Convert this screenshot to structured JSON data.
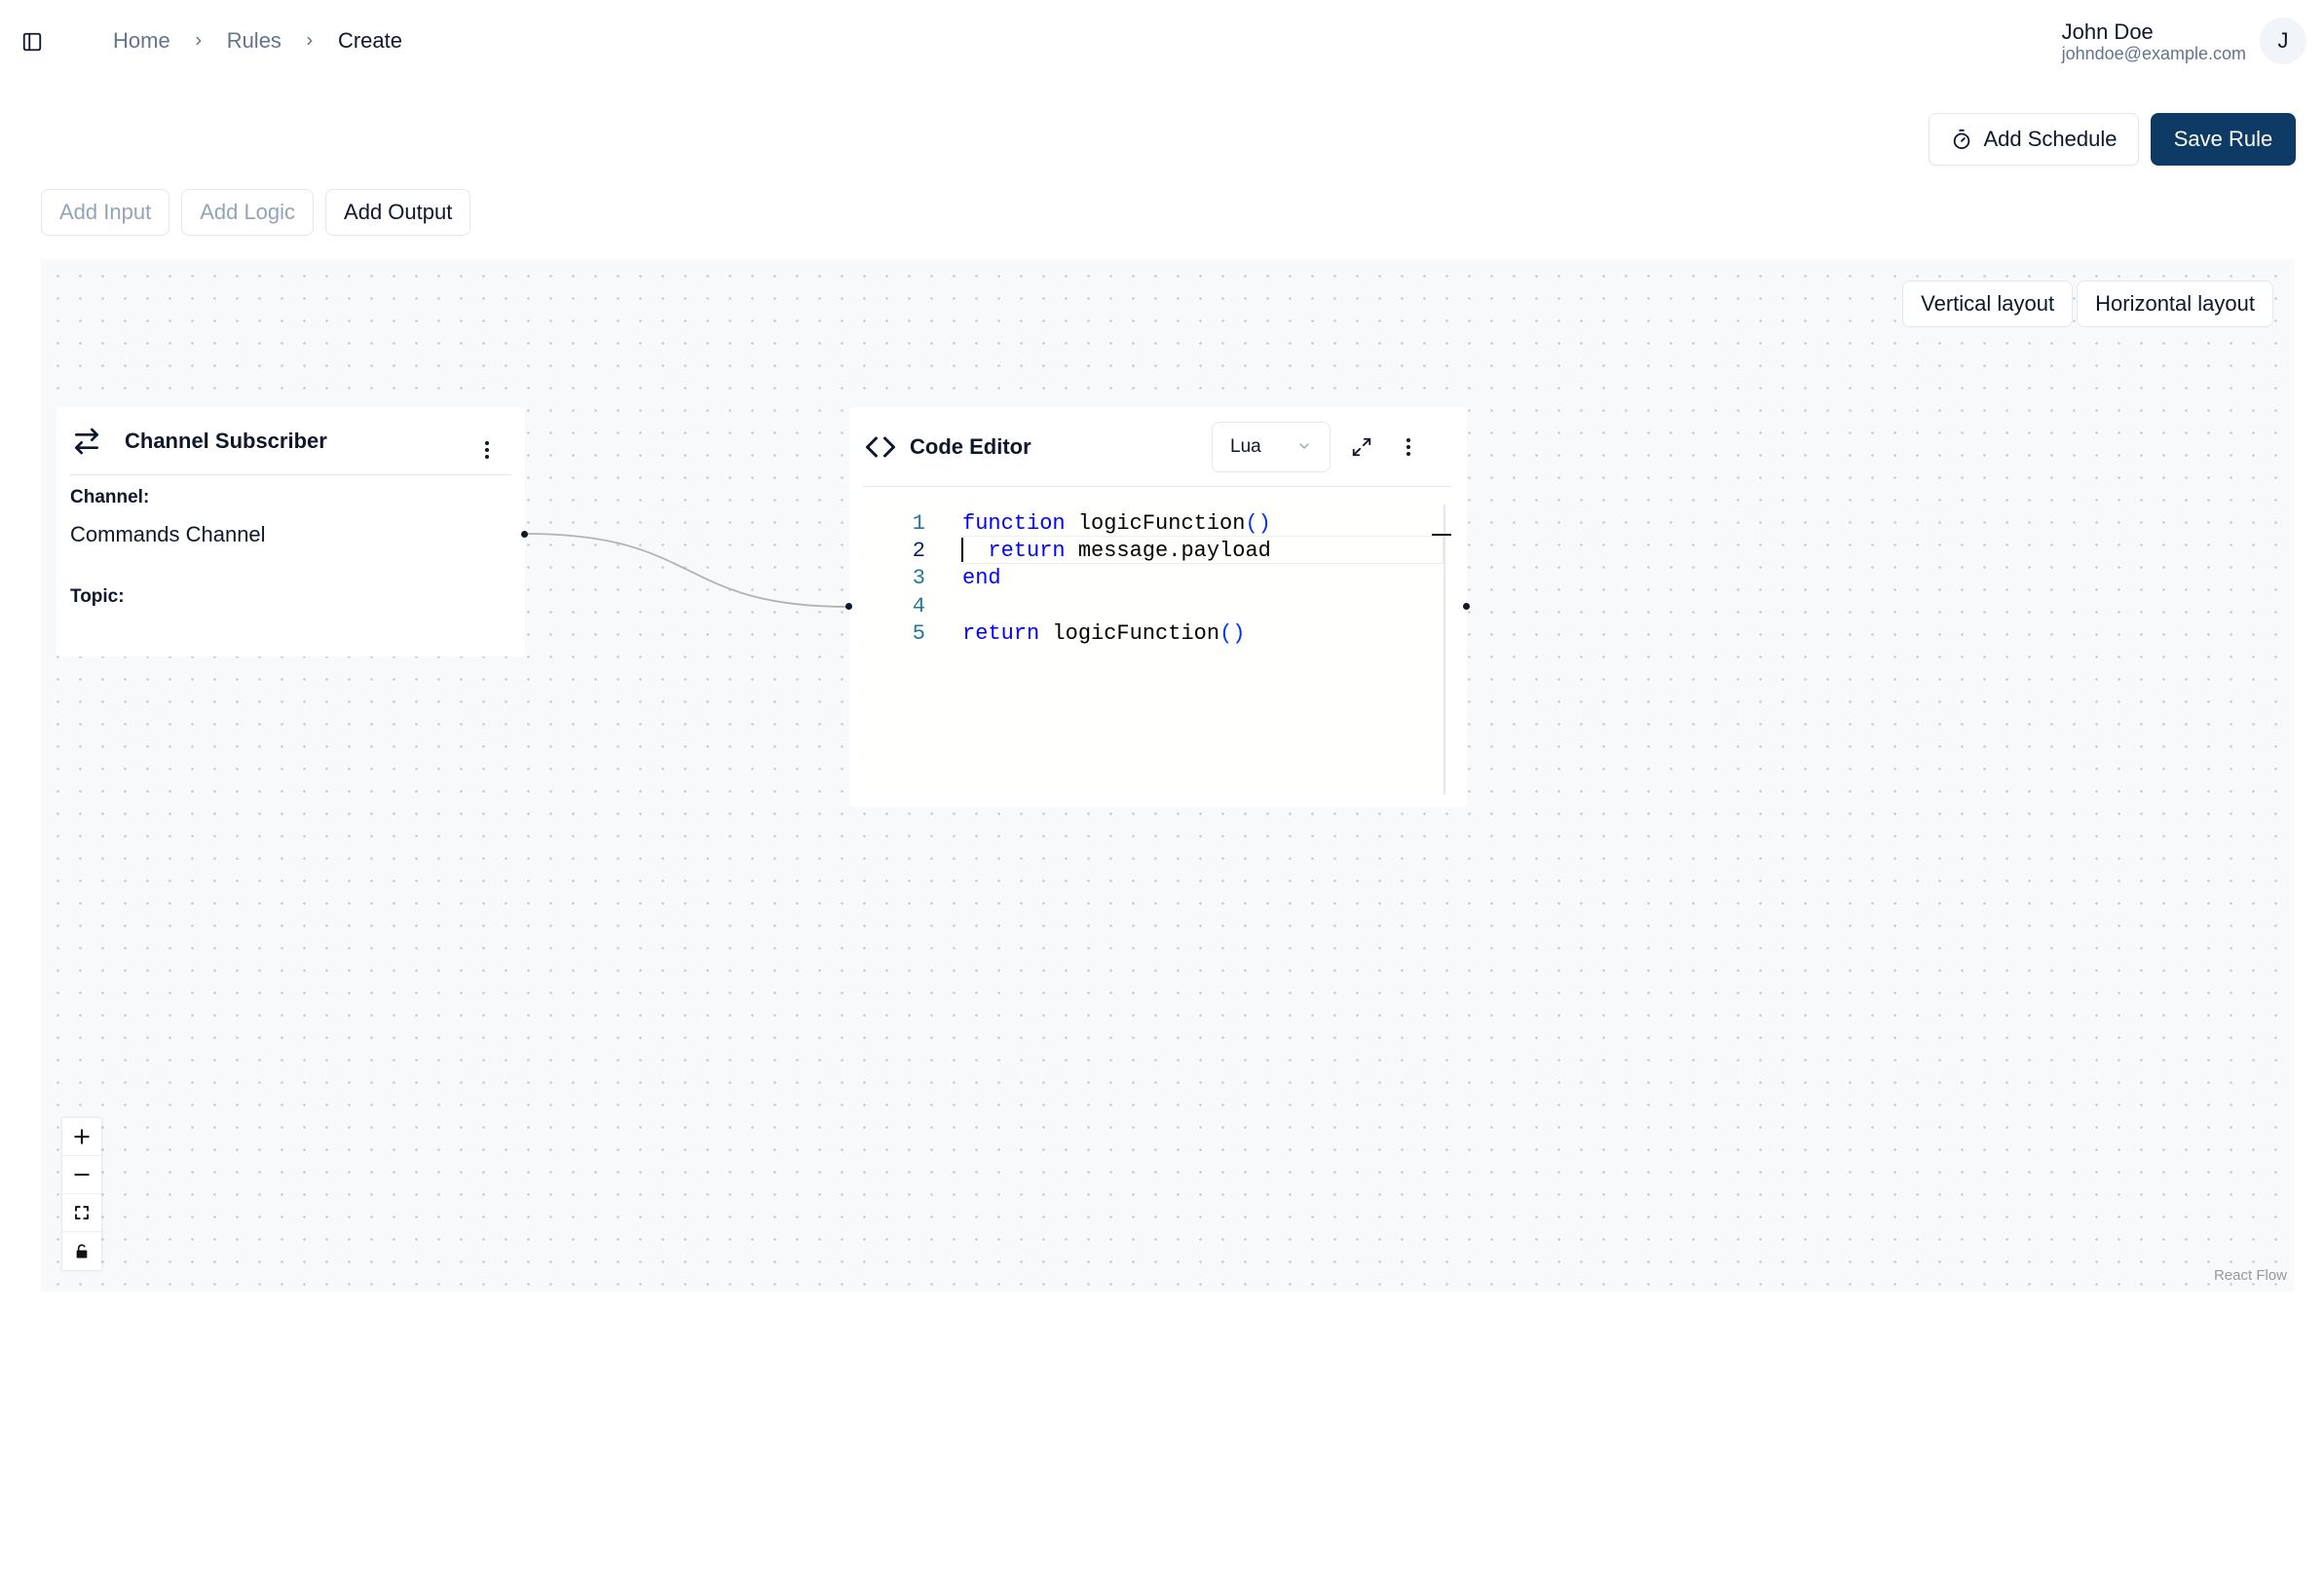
{
  "header": {
    "breadcrumb": [
      "Home",
      "Rules",
      "Create"
    ],
    "user": {
      "name": "John Doe",
      "email": "johndoe@example.com",
      "avatar_initial": "J"
    }
  },
  "actions": {
    "add_schedule": "Add Schedule",
    "save_rule": "Save Rule"
  },
  "toolbar": {
    "add_input": "Add Input",
    "add_logic": "Add Logic",
    "add_output": "Add Output"
  },
  "canvas": {
    "layout_buttons": {
      "vertical": "Vertical layout",
      "horizontal": "Horizontal layout"
    },
    "attribution": "React Flow"
  },
  "nodes": {
    "channel_subscriber": {
      "title": "Channel Subscriber",
      "channel_label": "Channel:",
      "channel_value": "Commands Channel",
      "topic_label": "Topic:",
      "topic_value": ""
    },
    "code_editor": {
      "title": "Code Editor",
      "language": "Lua",
      "active_line": 2,
      "lines": [
        {
          "n": "1",
          "code": "function logicFunction()"
        },
        {
          "n": "2",
          "code": "  return message.payload"
        },
        {
          "n": "3",
          "code": "end"
        },
        {
          "n": "4",
          "code": ""
        },
        {
          "n": "5",
          "code": "return logicFunction()"
        }
      ]
    }
  },
  "colors": {
    "primary": "#0d3b66",
    "canvas_bg": "#f8f9fb",
    "keyword": "#0000ff",
    "line_number": "#237893"
  }
}
